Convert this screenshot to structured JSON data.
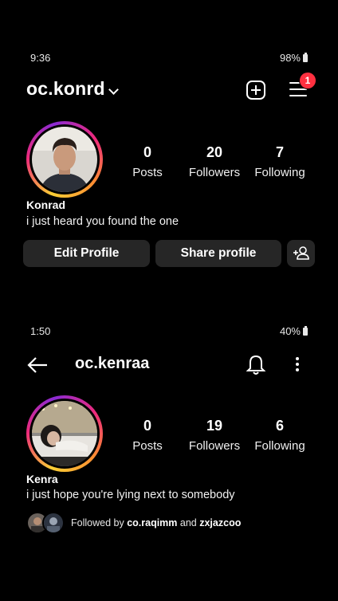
{
  "screen1": {
    "status": {
      "time": "9:36",
      "battery": "98%"
    },
    "header": {
      "username": "oc.konrd",
      "notification_count": "1"
    },
    "profile": {
      "stats": [
        {
          "value": "0",
          "label": "Posts"
        },
        {
          "value": "20",
          "label": "Followers"
        },
        {
          "value": "7",
          "label": "Following"
        }
      ],
      "name": "Konrad",
      "bio": "i just heard you found the one"
    },
    "buttons": {
      "edit": "Edit Profile",
      "share": "Share profile"
    }
  },
  "screen2": {
    "status": {
      "time": "1:50",
      "battery": "40%"
    },
    "header": {
      "username": "oc.kenraa"
    },
    "profile": {
      "stats": [
        {
          "value": "0",
          "label": "Posts"
        },
        {
          "value": "19",
          "label": "Followers"
        },
        {
          "value": "6",
          "label": "Following"
        }
      ],
      "name": "Kenra",
      "bio": "i just hope you're lying next to somebody"
    },
    "followed_by": {
      "prefix": "Followed by",
      "user1": "co.raqimm",
      "joiner": "and",
      "user2": "zxjazcoo"
    }
  },
  "colors": {
    "background": "#000000",
    "button_bg": "#262626",
    "notification_badge": "#ff3040"
  }
}
